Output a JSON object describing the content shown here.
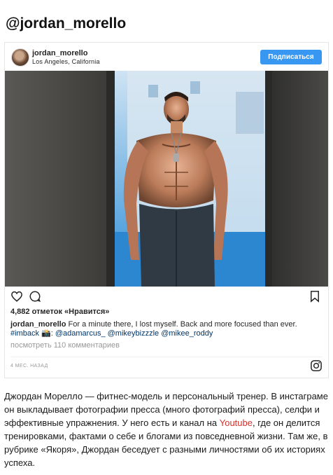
{
  "page": {
    "heading": "@jordan_morello"
  },
  "post": {
    "username": "jordan_morello",
    "location": "Los Angeles, California",
    "follow_label": "Подписаться",
    "likes_text": "4,882 отметок «Нравится»",
    "caption": {
      "username": "jordan_morello",
      "text": "For a minute there, I lost myself. Back and more focused than ever.",
      "hashtag": "#imback",
      "camera_emoji": "📸",
      "mentions": [
        "@adamarcus_",
        "@mikeybizzzle",
        "@mikee_roddy"
      ]
    },
    "view_comments": "посмотреть 110 комментариев",
    "timestamp": "4 МЕС. НАЗАД",
    "icons": {
      "like": "heart-icon",
      "comment": "comment-icon",
      "save": "bookmark-icon",
      "instagram": "instagram-icon"
    }
  },
  "article": {
    "text_before_link": "Джордан Морелло — фитнес-модель и персональный тренер. В инстаграме он выкладывает фотографии пресса (много фотографий пресса), селфи и эффективные упражнения. У него есть и канал на ",
    "link_text": "Youtube",
    "text_after_link": ", где он делится тренировками, фактами о себе и блогами из повседневной жизни. Там же, в рубрике «Якоря», Джордан беседует с разными личностями об их историях успеха.",
    "link_color": "#d8322b"
  },
  "colors": {
    "follow_button": "#3897f0",
    "muted": "#999999"
  }
}
